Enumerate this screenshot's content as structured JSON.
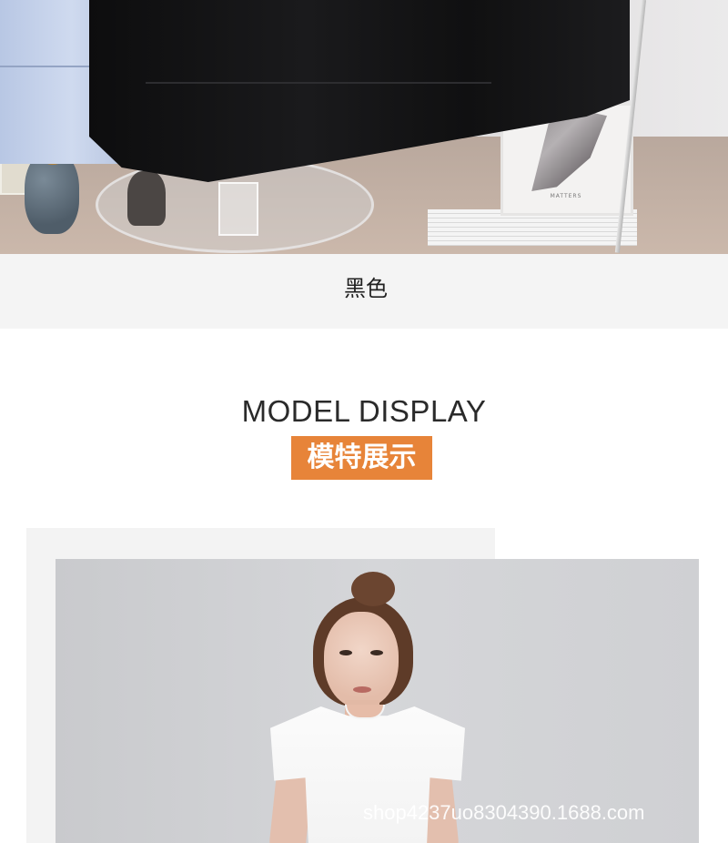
{
  "color_option": {
    "label": "黑色",
    "swatch_color": "#111111"
  },
  "section": {
    "title": "MODEL DISPLAY",
    "subtitle": "模特展示",
    "accent_color": "#e78439"
  },
  "photos": {
    "frame_brand": "MATTERS",
    "watermark": "shop4237uo8304390.1688.com"
  }
}
